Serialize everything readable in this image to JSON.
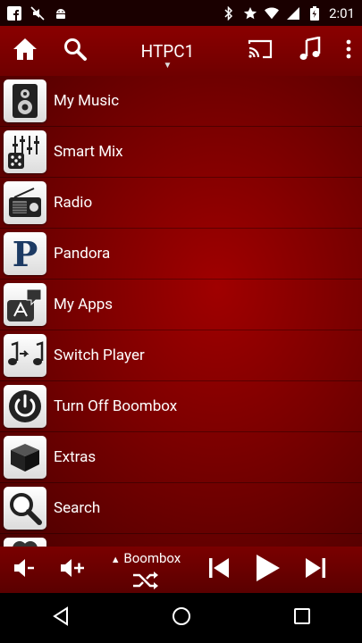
{
  "status_bar": {
    "time": "2:01"
  },
  "toolbar": {
    "title": "HTPC1"
  },
  "menu": {
    "items": [
      {
        "label": "My Music",
        "icon": "speaker-icon"
      },
      {
        "label": "Smart Mix",
        "icon": "mixer-dice-icon"
      },
      {
        "label": "Radio",
        "icon": "radio-icon"
      },
      {
        "label": "Pandora",
        "icon": "pandora-icon"
      },
      {
        "label": "My Apps",
        "icon": "apps-icon"
      },
      {
        "label": "Switch Player",
        "icon": "switch-player-icon"
      },
      {
        "label": "Turn Off Boombox",
        "icon": "power-icon"
      },
      {
        "label": "Extras",
        "icon": "box-icon"
      },
      {
        "label": "Search",
        "icon": "magnifier-icon"
      }
    ]
  },
  "player": {
    "device_label": "Boombox"
  },
  "colors": {
    "accent": "#8a0000",
    "background_center": "#a00000",
    "background_edge": "#4a0000"
  }
}
